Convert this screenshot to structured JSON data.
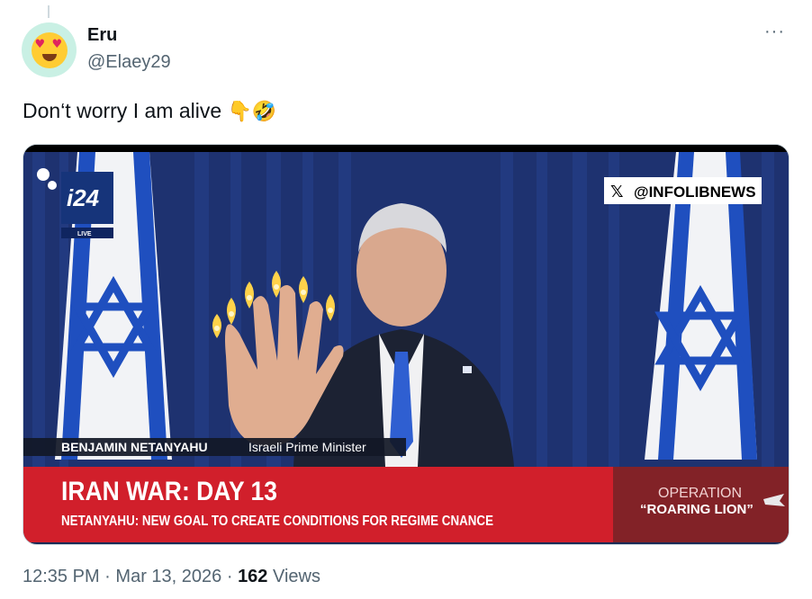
{
  "author": {
    "display_name": "Eru",
    "handle": "@Elaey29",
    "avatar_icon": "heart-eyes-emoji"
  },
  "more_icon": "more-dots-icon",
  "more_glyph": "···",
  "tweet": {
    "text": "Don‘t worry I am alive",
    "emojis": [
      "👇",
      "🤣"
    ]
  },
  "media": {
    "watermark": "@INFOLIBNEWS",
    "channel_logo": "i24",
    "live_label": "LIVE",
    "lower_third_name": "BENJAMIN NETANYAHU",
    "lower_third_role": "Israeli Prime Minister",
    "headline": "IRAN WAR: DAY 13",
    "subheadline": "NETANYAHU: NEW GOAL TO CREATE CONDITIONS FOR REGIME CNANCE",
    "operation_line1": "OPERATION",
    "operation_line2": "“ROARING LION”"
  },
  "timestamp": {
    "time": "12:35 PM",
    "separator": "·",
    "date": "Mar 13, 2026",
    "views_count": "162",
    "views_label": "Views"
  },
  "colors": {
    "text_primary": "#0f1419",
    "text_secondary": "#536471",
    "flag_blue": "#1f4fbf",
    "banner_red": "#d11f2b"
  }
}
